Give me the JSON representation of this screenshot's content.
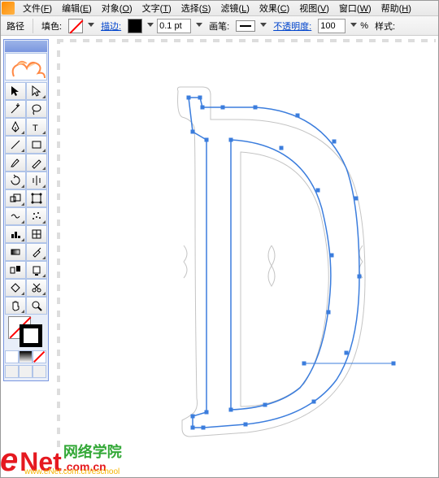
{
  "menu": {
    "items": [
      {
        "label": "文件",
        "accel": "F"
      },
      {
        "label": "编辑",
        "accel": "E"
      },
      {
        "label": "对象",
        "accel": "O"
      },
      {
        "label": "文字",
        "accel": "T"
      },
      {
        "label": "选择",
        "accel": "S"
      },
      {
        "label": "滤镜",
        "accel": "L"
      },
      {
        "label": "效果",
        "accel": "C"
      },
      {
        "label": "视图",
        "accel": "V"
      },
      {
        "label": "窗口",
        "accel": "W"
      },
      {
        "label": "帮助",
        "accel": "H"
      }
    ]
  },
  "options": {
    "mode": "路径",
    "fill_label": "填色:",
    "stroke_label": "描边:",
    "weight_value": "0.1 pt",
    "brush_label": "画笔:",
    "opacity_label": "不透明度:",
    "opacity_value": "100",
    "opacity_suffix": "%",
    "style_label": "样式:"
  },
  "watermark": {
    "brand_e": "e",
    "brand_net": "Net",
    "brand_dot": ".com",
    "brand_cn": "网络学院",
    "brand_dotcn": ".cn",
    "url": "www.eNet.com.cn/eschool"
  }
}
